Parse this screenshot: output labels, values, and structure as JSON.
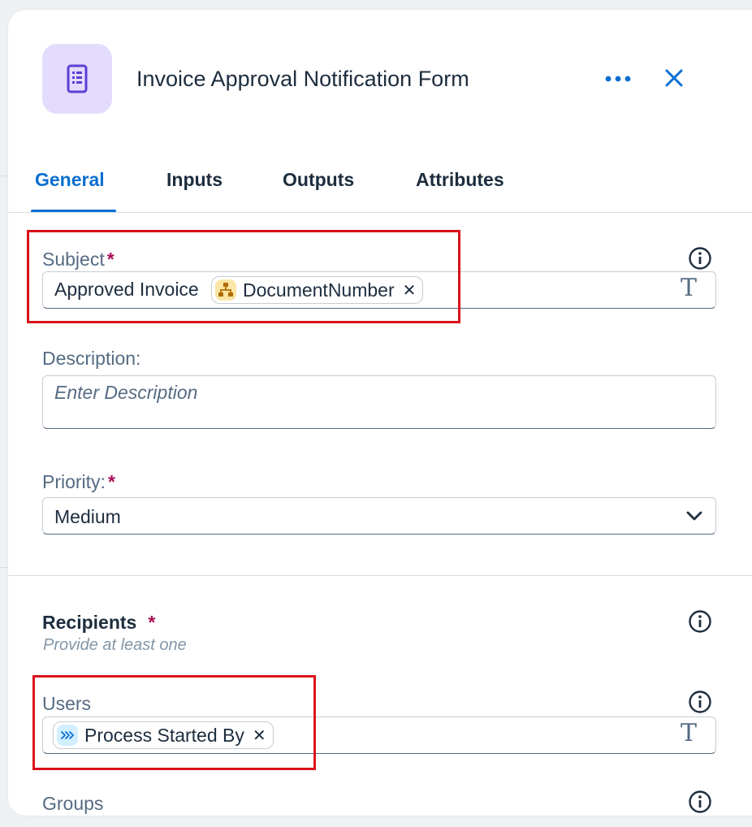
{
  "header": {
    "title": "Invoice Approval Notification Form",
    "icon": "form-document-icon",
    "accent_color": "#0a6ed1",
    "icon_bg_color": "#e3dcfc"
  },
  "tabs": [
    {
      "label": "General",
      "active": true
    },
    {
      "label": "Inputs",
      "active": false
    },
    {
      "label": "Outputs",
      "active": false
    },
    {
      "label": "Attributes",
      "active": false
    }
  ],
  "subject": {
    "label": "Subject",
    "required_mark": "*",
    "text": "Approved Invoice",
    "token": "DocumentNumber",
    "token_icon": "hierarchy-icon"
  },
  "description": {
    "label": "Description:",
    "placeholder": "Enter Description",
    "value": ""
  },
  "priority": {
    "label": "Priority:",
    "required_mark": "*",
    "value": "Medium"
  },
  "recipients": {
    "title": "Recipients",
    "required_mark": "*",
    "hint": "Provide at least one"
  },
  "users": {
    "label": "Users",
    "token": "Process Started By",
    "token_icon": "process-arrows-icon"
  },
  "groups": {
    "label": "Groups"
  },
  "text_mode_symbol": "T",
  "token_remove_symbol": "✕"
}
